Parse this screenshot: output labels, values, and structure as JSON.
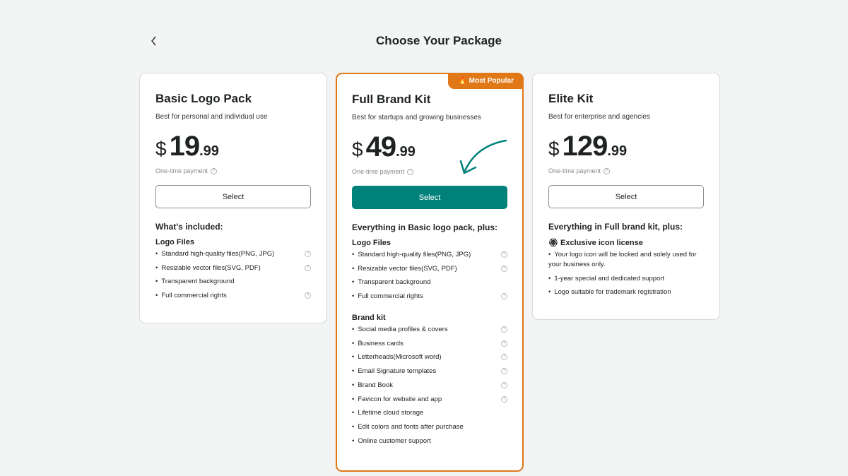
{
  "header": {
    "title": "Choose Your Package",
    "back_icon": "chevron-left-icon"
  },
  "colors": {
    "accent": "#00827a",
    "popular": "#e07818"
  },
  "plans": [
    {
      "name": "Basic Logo Pack",
      "subtitle": "Best for personal and individual use",
      "currency": "$",
      "price_int": "19",
      "price_dec": ".99",
      "payment": "One-time payment",
      "button": "Select",
      "included_title": "What's included:",
      "groups": [
        {
          "title": "Logo Files",
          "items": [
            {
              "text": "Standard high-quality files(PNG, JPG)",
              "help": true
            },
            {
              "text": "Resizable vector files(SVG, PDF)",
              "help": true
            },
            {
              "text": "Transparent background",
              "help": false
            },
            {
              "text": "Full commercial rights",
              "help": true
            }
          ]
        }
      ]
    },
    {
      "name": "Full Brand Kit",
      "badge": "Most Popular",
      "subtitle": "Best for startups and growing businesses",
      "currency": "$",
      "price_int": "49",
      "price_dec": ".99",
      "payment": "One-time payment",
      "button": "Select",
      "included_title": "Everything in Basic logo pack, plus:",
      "groups": [
        {
          "title": "Logo Files",
          "items": [
            {
              "text": "Standard high-quality files(PNG, JPG)",
              "help": true
            },
            {
              "text": "Resizable vector files(SVG, PDF)",
              "help": true
            },
            {
              "text": "Transparent background",
              "help": false
            },
            {
              "text": "Full commercial rights",
              "help": true
            }
          ]
        },
        {
          "title": "Brand kit",
          "items": [
            {
              "text": "Social media profiles & covers",
              "help": true
            },
            {
              "text": "Business cards",
              "help": true
            },
            {
              "text": "Letterheads(Microsoft word)",
              "help": true
            },
            {
              "text": "Email Signature templates",
              "help": true
            },
            {
              "text": "Brand Book",
              "help": true
            },
            {
              "text": "Favicon for website and app",
              "help": true
            },
            {
              "text": "Lifetime cloud storage",
              "help": false
            },
            {
              "text": "Edit colors and fonts after purchase",
              "help": false
            },
            {
              "text": "Online customer support",
              "help": false
            }
          ]
        }
      ]
    },
    {
      "name": "Elite Kit",
      "subtitle": "Best for enterprise and agencies",
      "currency": "$",
      "price_int": "129",
      "price_dec": ".99",
      "payment": "One-time payment",
      "button": "Select",
      "included_title": "Everything in Full brand kit, plus:",
      "groups": [
        {
          "title": "Exclusive icon license",
          "icon": "award-icon",
          "items": [
            {
              "text": "Your logo icon will be locked and solely used for your business only.",
              "help": false
            },
            {
              "text": "1-year special and dedicated support",
              "help": false
            },
            {
              "text": "Logo suitable for trademark registration",
              "help": false
            }
          ]
        }
      ]
    }
  ]
}
